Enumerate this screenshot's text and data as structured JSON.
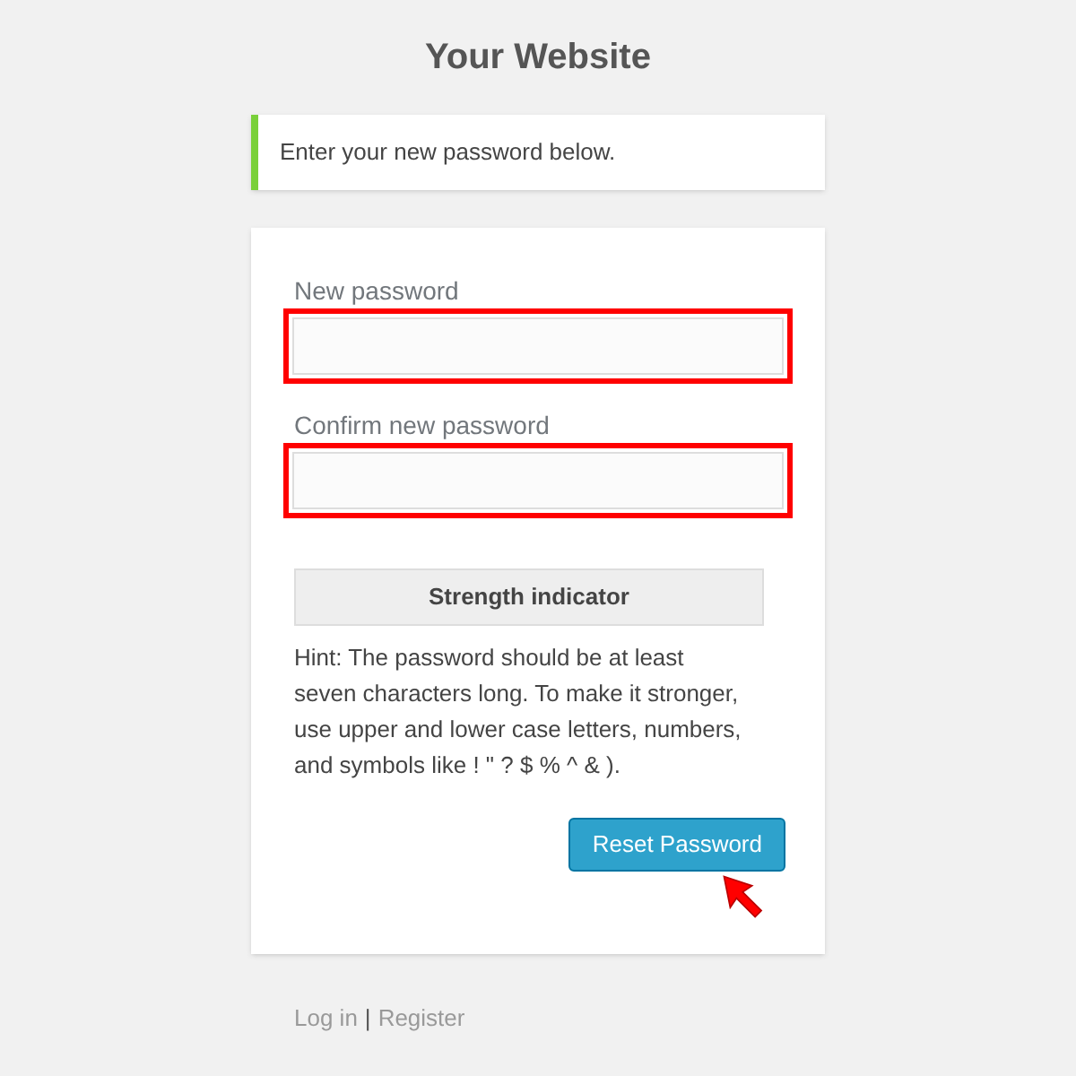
{
  "site_title": "Your Website",
  "message": "Enter your new password below.",
  "fields": [
    {
      "label": "New password",
      "highlighted": true
    },
    {
      "label": "Confirm new password",
      "highlighted": true
    }
  ],
  "strength_indicator": "Strength indicator",
  "hint": "Hint: The password should be at least seven characters long. To make it stronger, use upper and lower case letters, numbers, and symbols like ! \" ? $ % ^ & ).",
  "submit_button": {
    "label": "Reset Password",
    "pointed_at": true
  },
  "footer_links": [
    {
      "label": "Log in"
    },
    {
      "label": "Register"
    }
  ],
  "footer_separator": "|"
}
